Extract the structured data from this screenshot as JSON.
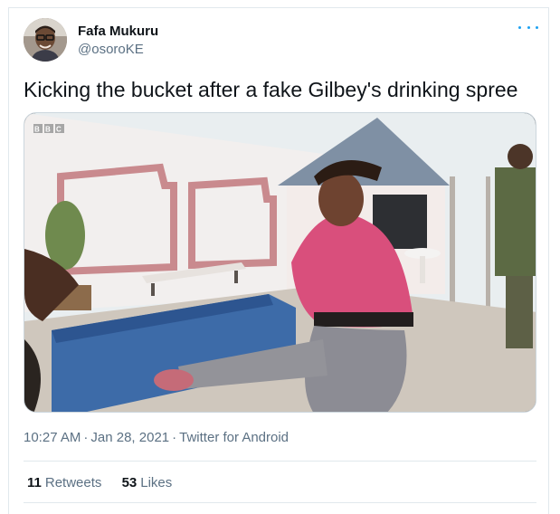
{
  "tweet": {
    "author_name": "Fafa Mukuru",
    "author_handle": "@osoroKE",
    "text": "Kicking the bucket after a fake Gilbey's drinking spree",
    "media_watermark": "BBC",
    "time": "10:27 AM",
    "date": "Jan 28, 2021",
    "source": "Twitter for Android",
    "retweets_count": "11",
    "retweets_label": "Retweets",
    "likes_count": "53",
    "likes_label": "Likes"
  },
  "icons": {
    "more": "more-horizontal-icon"
  },
  "colors": {
    "accent": "#1da1f2",
    "secondary_text": "#5b7083",
    "primary_text": "#0f1419",
    "border": "#e1e8ed"
  }
}
